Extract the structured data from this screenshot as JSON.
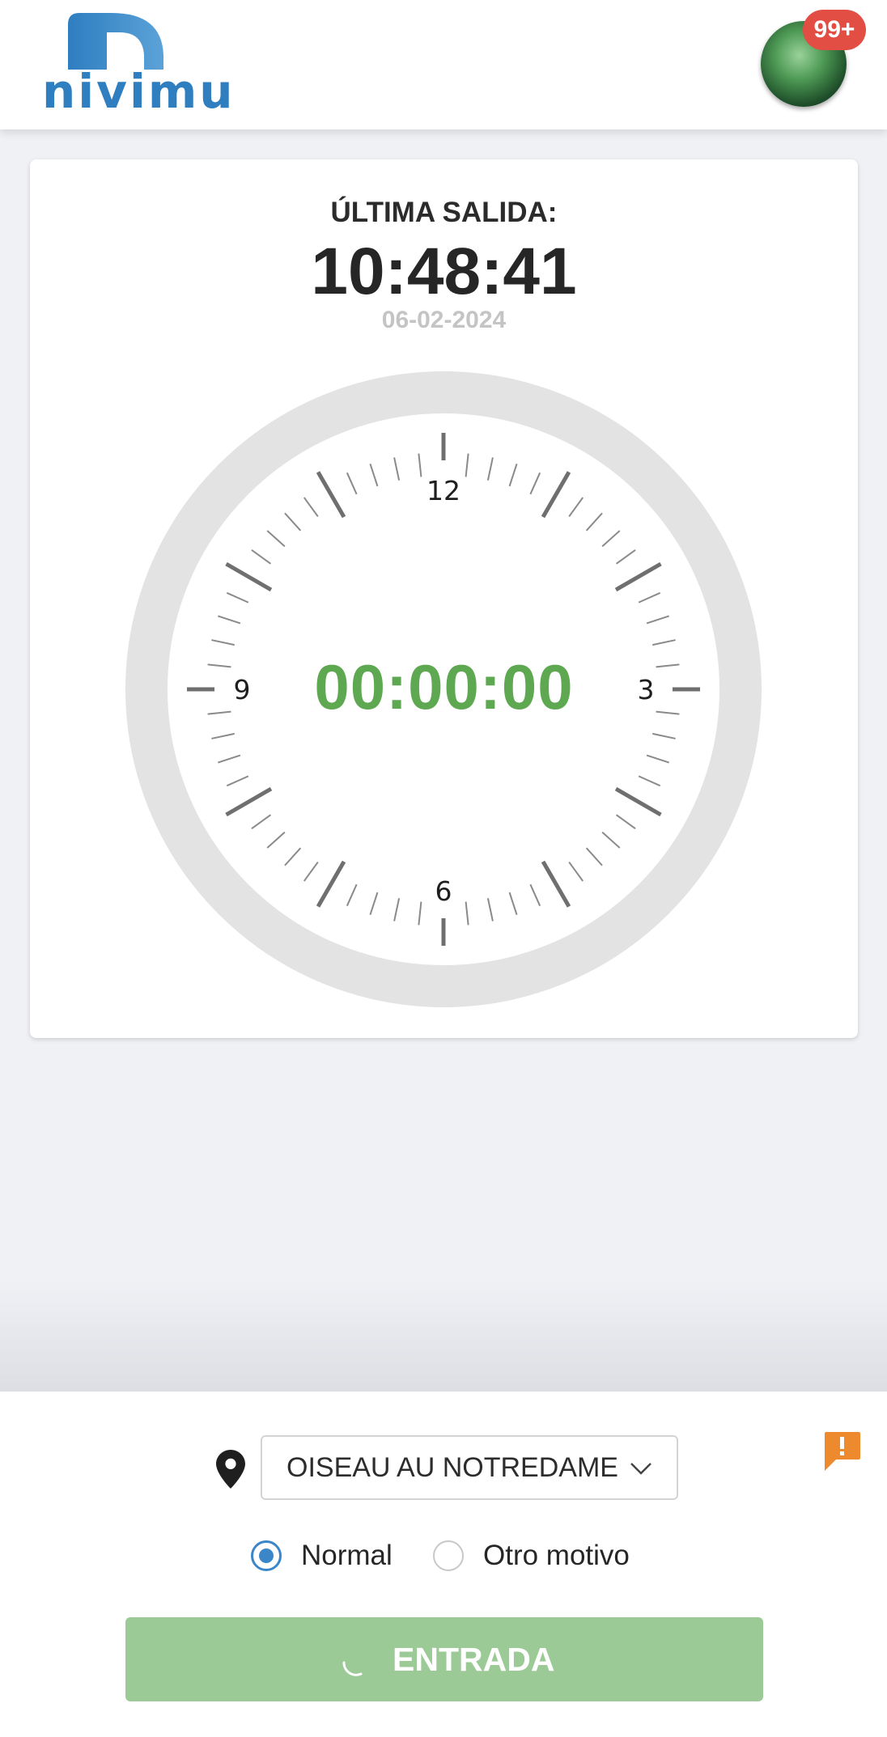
{
  "header": {
    "logo_text": "nivimu",
    "notifications_badge": "99+"
  },
  "last_exit": {
    "title": "ÚLTIMA SALIDA:",
    "time": "10:48:41",
    "date": "06-02-2024"
  },
  "clock": {
    "numbers": {
      "twelve": "12",
      "three": "3",
      "six": "6",
      "nine": "9"
    },
    "timer": "00:00:00"
  },
  "footer": {
    "location_value": "OISEAU AU NOTREDAME",
    "radio_normal_label": "Normal",
    "radio_other_label": "Otro motivo",
    "selected_reason": "Normal",
    "entry_button_label": "ENTRADA"
  },
  "colors": {
    "brand_blue": "#2f7ec0",
    "timer_green": "#5ea852",
    "button_green": "#9cca97",
    "badge_red": "#e24d44",
    "alert_orange": "#ec8a2d"
  },
  "icons": [
    "location-pin-icon",
    "chevron-down-icon",
    "alert-icon",
    "spinner-icon",
    "avatar"
  ]
}
